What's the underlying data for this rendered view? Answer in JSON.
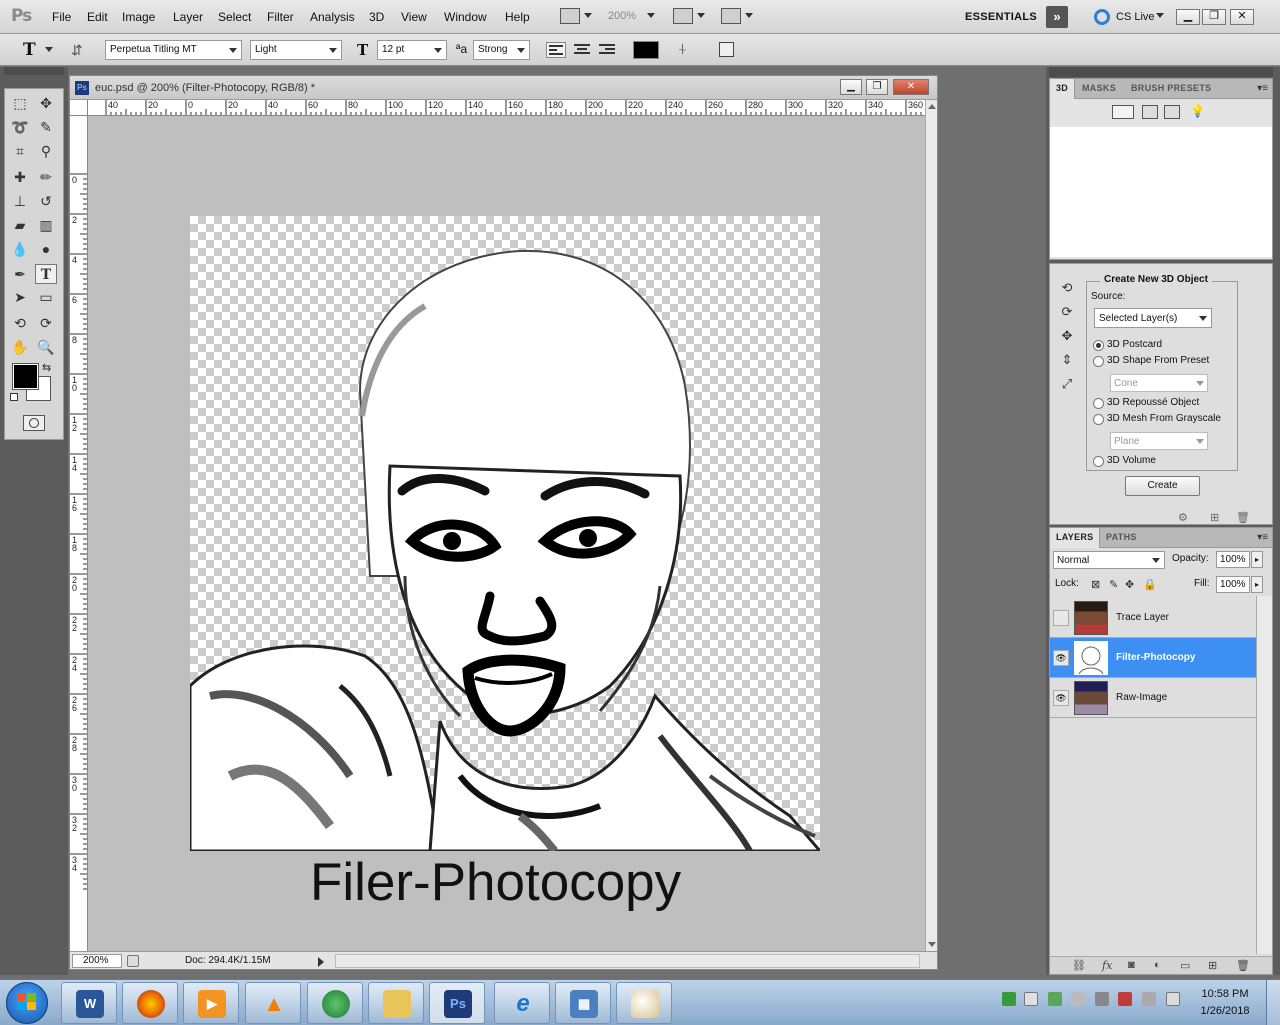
{
  "app": {
    "logo": "Ps",
    "menu": [
      "File",
      "Edit",
      "Image",
      "Layer",
      "Select",
      "Filter",
      "Analysis",
      "3D",
      "View",
      "Window",
      "Help"
    ],
    "zoom": "200%",
    "workspace": "ESSENTIALS",
    "cs_live": "CS Live"
  },
  "options": {
    "tool_glyph": "T",
    "font_family": "Perpetua Titling MT",
    "font_style": "Light",
    "font_size": "12 pt",
    "aa_glyph": "ªa",
    "antialias": "Strong",
    "text_color": "#000000"
  },
  "document": {
    "title": "euc.psd @ 200% (Filter-Photocopy, RGB/8) *",
    "zoom": "200%",
    "doc_info": "Doc: 294.4K/1.15M",
    "ruler_top": [
      "40",
      "20",
      "0",
      "20",
      "40",
      "60",
      "80",
      "100",
      "120",
      "140",
      "160",
      "180",
      "200",
      "220",
      "240",
      "260",
      "280",
      "300",
      "320",
      "340",
      "360"
    ],
    "ruler_left": [
      "0",
      "2",
      "4",
      "6",
      "8",
      "10",
      "12",
      "14",
      "16",
      "18",
      "20",
      "22",
      "24",
      "26",
      "28",
      "30",
      "32",
      "34"
    ],
    "caption": "Filer-Photocopy"
  },
  "panel3d": {
    "tabs": [
      "3D",
      "MASKS",
      "BRUSH PRESETS"
    ],
    "group_title": "Create New 3D Object",
    "source_label": "Source:",
    "source_value": "Selected Layer(s)",
    "options": [
      {
        "label": "3D Postcard",
        "checked": true
      },
      {
        "label": "3D Shape From Preset",
        "checked": false
      },
      {
        "label": "3D Repoussé Object",
        "checked": false
      },
      {
        "label": "3D Mesh From Grayscale",
        "checked": false
      },
      {
        "label": "3D Volume",
        "checked": false
      }
    ],
    "preset_value": "Cone",
    "mesh_value": "Plane",
    "create_label": "Create"
  },
  "layers": {
    "tabs": [
      "LAYERS",
      "PATHS"
    ],
    "blend_mode": "Normal",
    "opacity_label": "Opacity:",
    "opacity": "100%",
    "lock_label": "Lock:",
    "fill_label": "Fill:",
    "fill": "100%",
    "items": [
      {
        "name": "Trace Layer",
        "visible": false,
        "selected": false
      },
      {
        "name": "Filter-Photocopy",
        "visible": true,
        "selected": true
      },
      {
        "name": "Raw-Image",
        "visible": true,
        "selected": false
      }
    ]
  },
  "taskbar": {
    "apps": [
      "word",
      "firefox",
      "media-player",
      "vlc",
      "media-center",
      "file-explorer",
      "photoshop",
      "internet-explorer",
      "remote-desktop",
      "paint"
    ],
    "time": "10:58 PM",
    "date": "1/26/2018"
  },
  "colors": {
    "selection": "#3d8ff3",
    "taskbar": "#a6c0de",
    "foreground": "#000000",
    "background": "#ffffff"
  }
}
